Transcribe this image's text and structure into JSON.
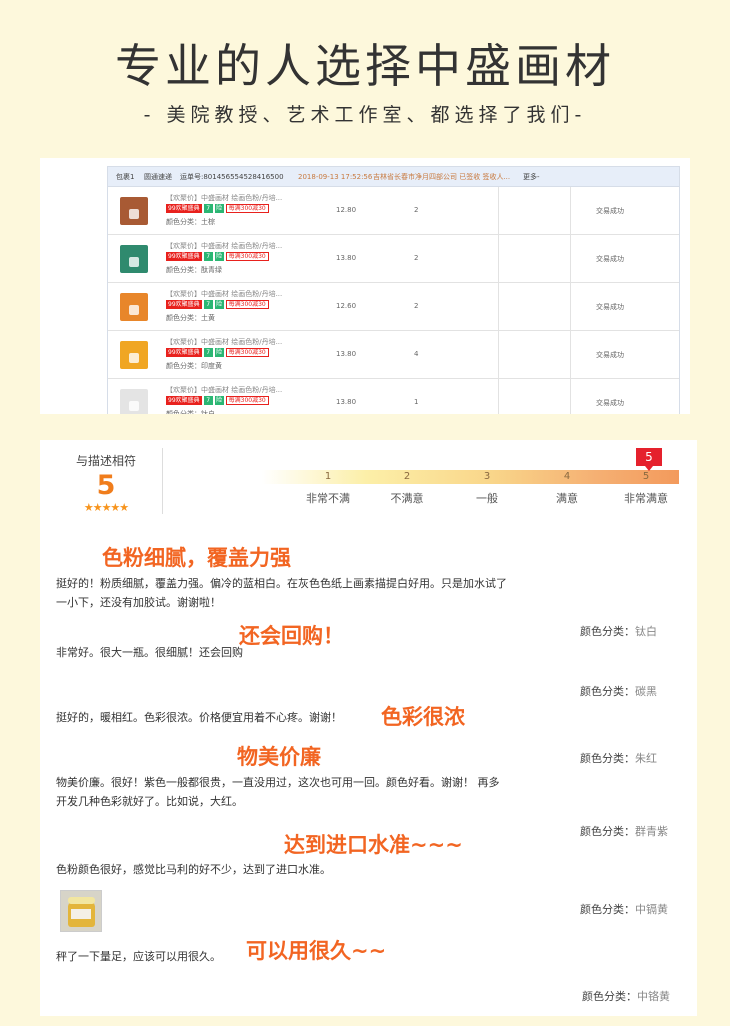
{
  "hero": {
    "title": "专业的人选择中盛画材",
    "subtitle": "- 美院教授、艺术工作室、都选择了我们-"
  },
  "orders": {
    "header": {
      "package": "包裹1",
      "courier": "圆通速递",
      "tracking": "运单号:801456554528416500",
      "time": "2018-09-13 17:52:56",
      "address": "吉林省长春市净月四部公司 已签收 签收人...",
      "more": "更多-"
    },
    "badge_labels": {
      "promo": "99欢聚盛典",
      "seven": "7",
      "guarantee": "险",
      "discount": "每满300减30"
    },
    "items": [
      {
        "name": "【欢聚价】中盛画材 绘画色粉/丹培...",
        "color": "颜色分类：土棕",
        "price": "12.80",
        "qty": "2",
        "status": "交易成功",
        "swatch": "#a85a34"
      },
      {
        "name": "【欢聚价】中盛画材 绘画色粉/丹培...",
        "color": "颜色分类：酞青绿",
        "price": "13.80",
        "qty": "2",
        "status": "交易成功",
        "swatch": "#2f8a6e"
      },
      {
        "name": "【欢聚价】中盛画材 绘画色粉/丹培...",
        "color": "颜色分类：土黄",
        "price": "12.60",
        "qty": "2",
        "status": "交易成功",
        "swatch": "#e8862a"
      },
      {
        "name": "【欢聚价】中盛画材 绘画色粉/丹培...",
        "color": "颜色分类：印度黄",
        "price": "13.80",
        "qty": "4",
        "status": "交易成功",
        "swatch": "#f0a623"
      },
      {
        "name": "【欢聚价】中盛画材 绘画色粉/丹培...",
        "color": "颜色分类：钛白",
        "price": "13.80",
        "qty": "1",
        "status": "交易成功",
        "swatch": "#e4e4e4"
      }
    ]
  },
  "rating": {
    "label": "与描述相符",
    "score": "5",
    "stars": "★★★★★",
    "marker": "5",
    "scale": [
      {
        "num": "1",
        "label": "非常不满"
      },
      {
        "num": "2",
        "label": "不满意"
      },
      {
        "num": "3",
        "label": "一般"
      },
      {
        "num": "4",
        "label": "满意"
      },
      {
        "num": "5",
        "label": "非常满意"
      }
    ]
  },
  "reviews": {
    "tag1": "色粉细腻，覆盖力强",
    "text1a": "挺好的！粉质细腻，覆盖力强。偏冷的蓝相白。在灰色色纸上画素描提白好用。只是加水试了",
    "text1b": "一小下，还没有加胶试。谢谢啦！",
    "cat1_label": "颜色分类：",
    "cat1_value": "钛白",
    "tag2": "还会回购！",
    "text2": "非常好。很大一瓶。很细腻！还会回购",
    "cat2_label": "颜色分类：",
    "cat2_value": "碳黑",
    "text3": "挺好的，暖相红。色彩很浓。价格便宜用着不心疼。谢谢！",
    "tag3": "色彩很浓",
    "tag4": "物美价廉",
    "cat3_label": "颜色分类：",
    "cat3_value": "朱红",
    "text4a": "物美价廉。很好！紫色一般都很贵，一直没用过，这次也可用一回。颜色好看。谢谢！ 再多",
    "text4b": "开发几种色彩就好了。比如说，大红。",
    "cat4_label": "颜色分类：",
    "cat4_value": "群青紫",
    "tag5": "达到进口水准~~~",
    "text5": "色粉颜色很好，感觉比马利的好不少，达到了进口水准。",
    "cat5_label": "颜色分类：",
    "cat5_value": "中镉黄",
    "text6": "秤了一下量足，应该可以用很久。",
    "tag6": "可以用很久~~",
    "cat6_label": "颜色分类：",
    "cat6_value": "中铬黄"
  }
}
